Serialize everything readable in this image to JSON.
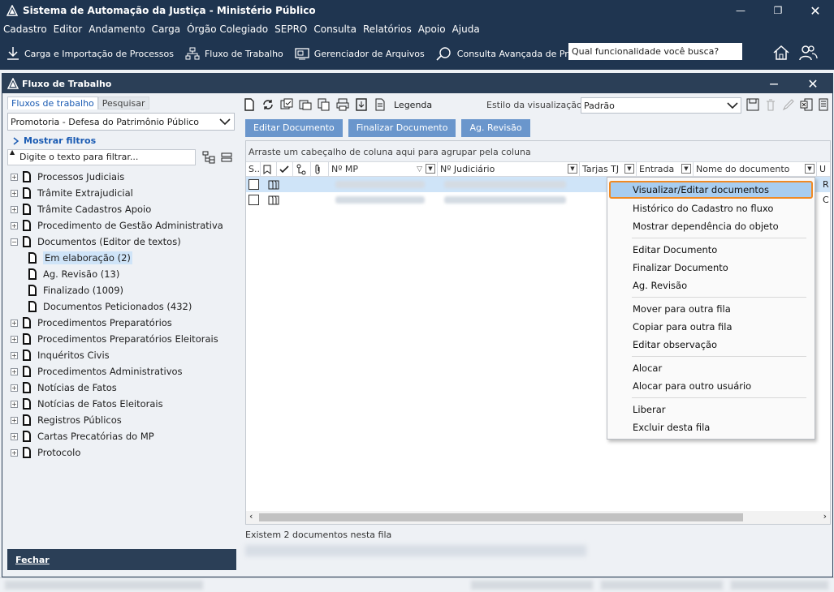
{
  "window": {
    "title": "Sistema de Automação da Justiça - Ministério Público",
    "minimize": "—",
    "maximize": "❐",
    "close": "✕"
  },
  "menu": [
    "Cadastro",
    "Editor",
    "Andamento",
    "Carga",
    "Órgão Colegiado",
    "SEPRO",
    "Consulta",
    "Relatórios",
    "Apoio",
    "Ajuda"
  ],
  "quickbar": {
    "items": [
      "Carga e Importação de Processos",
      "Fluxo de Trabalho",
      "Gerenciador de Arquivos",
      "Consulta Avançada de Processos"
    ],
    "search_value": "Qual funcionalidade você busca?"
  },
  "panel": {
    "title": "Fluxo de Trabalho",
    "minimize": "—",
    "close": "✕"
  },
  "left": {
    "tabs": [
      "Fluxos de trabalho",
      "Pesquisar"
    ],
    "combo_value": "Promotoria - Defesa do Patrimônio Público",
    "show_filters": "Mostrar filtros",
    "filter_placeholder": "Digite o texto para filtrar...",
    "tree": [
      {
        "label": "Processos Judiciais",
        "type": "root"
      },
      {
        "label": "Trâmite Extrajudicial",
        "type": "root"
      },
      {
        "label": "Trâmite Cadastros Apoio",
        "type": "root"
      },
      {
        "label": "Procedimento de Gestão Administrativa",
        "type": "root"
      },
      {
        "label": "Documentos (Editor de textos)",
        "type": "root-open"
      },
      {
        "label": "Em elaboração (2)",
        "type": "child-selected"
      },
      {
        "label": "Ag. Revisão (13)",
        "type": "child"
      },
      {
        "label": "Finalizado (1009)",
        "type": "child"
      },
      {
        "label": "Documentos Peticionados (432)",
        "type": "child"
      },
      {
        "label": "Procedimentos Preparatórios",
        "type": "root"
      },
      {
        "label": "Procedimentos Preparatórios Eleitorais",
        "type": "root"
      },
      {
        "label": "Inquéritos Civis",
        "type": "root"
      },
      {
        "label": "Procedimentos Administrativos",
        "type": "root"
      },
      {
        "label": "Notícias de Fatos",
        "type": "root"
      },
      {
        "label": "Notícias de Fatos Eleitorais",
        "type": "root"
      },
      {
        "label": "Registros Públicos",
        "type": "root"
      },
      {
        "label": "Cartas Precatórias do MP",
        "type": "root"
      },
      {
        "label": "Protocolo",
        "type": "root"
      }
    ],
    "close_label": "Fechar"
  },
  "right": {
    "legend": "Legenda",
    "view_style_label": "Estilo da visualização",
    "view_style_value": "Padrão",
    "actions": [
      "Editar Documento",
      "Finalizar Documento",
      "Ag. Revisão"
    ],
    "group_hint": "Arraste um cabeçalho de coluna aqui para agrupar pela coluna",
    "columns": [
      "S...",
      "",
      "",
      "",
      "",
      "Nº MP",
      "Nº Judiciário",
      "Tarjas TJ",
      "Entrada",
      "Nome do documento",
      "U"
    ],
    "row_tail": [
      "R",
      "C"
    ],
    "status": "Existem 2 documentos nesta fila"
  },
  "context_menu": {
    "items": [
      "Visualizar/Editar documentos",
      "Histórico do Cadastro no fluxo",
      "Mostrar dependência do objeto",
      "---",
      "Editar Documento",
      "Finalizar Documento",
      "Ag. Revisão",
      "---",
      "Mover para outra fila",
      "Copiar para outra fila",
      "Editar observação",
      "---",
      "Alocar",
      "Alocar para outro usuário",
      "---",
      "Liberar",
      "Excluir desta fila"
    ]
  },
  "colors": {
    "titlebar": "#1f3550",
    "panel_title": "#2b3f57",
    "action_button": "#6a96cc",
    "selection": "#cfe4f8",
    "menu_highlight": "#a8cdf0",
    "highlight_border": "#f08a24"
  }
}
